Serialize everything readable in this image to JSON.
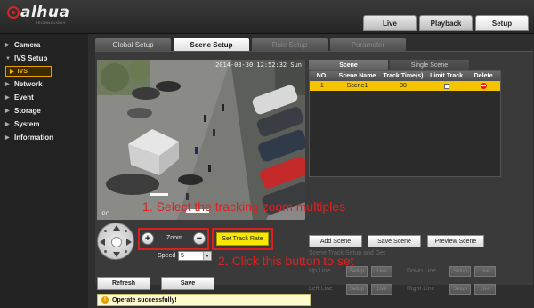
{
  "brand": {
    "name": "alhua",
    "tagline": "TECHNOLOGY"
  },
  "top_tabs": [
    {
      "label": "Live"
    },
    {
      "label": "Playback"
    },
    {
      "label": "Setup"
    }
  ],
  "sidebar": {
    "items": [
      {
        "label": "Camera"
      },
      {
        "label": "IVS Setup"
      },
      {
        "label": "IVS"
      },
      {
        "label": "Network"
      },
      {
        "label": "Event"
      },
      {
        "label": "Storage"
      },
      {
        "label": "System"
      },
      {
        "label": "Information"
      }
    ]
  },
  "sub_tabs": [
    {
      "label": "Global Setup"
    },
    {
      "label": "Scene Setup"
    },
    {
      "label": "Rule Setup"
    },
    {
      "label": "Parameter"
    }
  ],
  "video": {
    "timestamp": "2014-03-30 12:52:32 Sun",
    "camera_label": "IPC"
  },
  "ptz": {
    "zoom_label": "Zoom",
    "speed_label": "Speed",
    "speed_value": "5",
    "set_track_rate": "Set Track Rate"
  },
  "scene_tabs": [
    {
      "label": "Scene"
    },
    {
      "label": "Single Scene"
    }
  ],
  "scene_table": {
    "headers": [
      "NO.",
      "Scene Name",
      "Track Time(s)",
      "Limit Track",
      "Delete"
    ],
    "rows": [
      {
        "no": "1",
        "name": "Scene1",
        "track_time": "30"
      }
    ]
  },
  "scene_buttons": {
    "add": "Add Scene",
    "save": "Save Scene",
    "preview": "Preview Scene",
    "track_setup_title": "Scene Track Setup and Get",
    "up_line": "Up Line",
    "down_line": "Down Line",
    "left_line": "Left Line",
    "right_line": "Right Line",
    "setup": "Setup",
    "live": "Live"
  },
  "bottom": {
    "refresh": "Refresh",
    "save": "Save",
    "status": "Operate successfully!"
  },
  "annotations": {
    "step1": "1. Select the tracking zoom multiples",
    "step2": "2. Click this button to set"
  },
  "colors": {
    "accent": "#f4c400",
    "highlight_box": "#d82020",
    "annotation_text": "#e02020"
  }
}
